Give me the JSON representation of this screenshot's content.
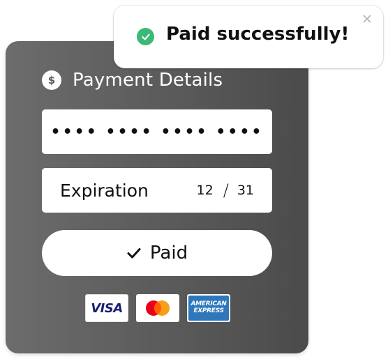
{
  "card": {
    "title": "Payment Details",
    "currency_icon": "dollar-icon",
    "card_number_masked": "•••• •••• •••• ••••",
    "expiration_label": "Expiration",
    "expiration_month": "12",
    "expiration_separator": "/",
    "expiration_year": "31",
    "paid_button_label": "Paid",
    "paid_button_icon": "check-icon",
    "brands": [
      {
        "name": "visa",
        "label": "VISA"
      },
      {
        "name": "mastercard",
        "label": ""
      },
      {
        "name": "amex",
        "line1": "AMERICAN",
        "line2": "EXPRESS"
      }
    ],
    "colors": {
      "card_background": "#5a5a5a",
      "visa": "#1a1f71",
      "mastercard_red": "#eb001b",
      "mastercard_orange": "#f79e1b",
      "amex": "#2e77bb"
    }
  },
  "toast": {
    "message": "Paid successfully!",
    "status_icon": "check-circle-icon",
    "close_icon": "close-icon",
    "colors": {
      "success": "#3cb878"
    }
  }
}
